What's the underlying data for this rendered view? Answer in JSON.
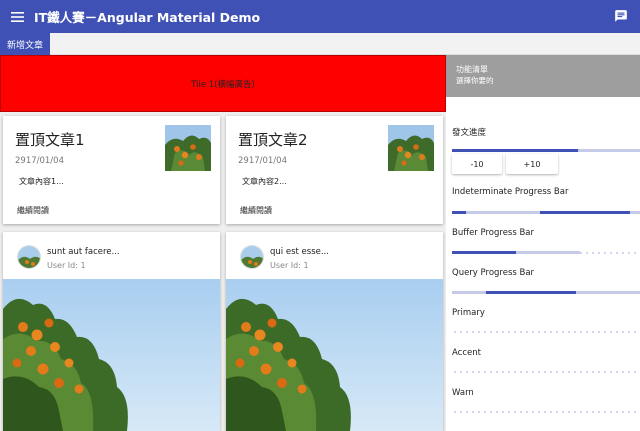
{
  "header": {
    "title": "IT鐵人賽－Angular Material Demo",
    "menu_icon": "menu-icon",
    "chat_icon": "chat-icon"
  },
  "tabs": [
    {
      "label": "新增文章",
      "active": true
    }
  ],
  "banner_tile": {
    "label": "Tile 1(橫幅廣告)"
  },
  "side_header": {
    "title": "功能清單",
    "subtitle": "選擇你要的"
  },
  "pinned_posts": [
    {
      "title": "置頂文章1",
      "date": "2917/01/04",
      "body": "文章內容1...",
      "read_more": "繼續閱讀"
    },
    {
      "title": "置頂文章2",
      "date": "2917/01/04",
      "body": "文章內容2...",
      "read_more": "繼續閱讀"
    }
  ],
  "posts": [
    {
      "title": "sunt aut facere...",
      "user": "User Id: 1"
    },
    {
      "title": "qui est esse...",
      "user": "User Id: 1"
    }
  ],
  "progress": {
    "heading": "發文進度",
    "value_fraction": 0.67,
    "minus_label": "-10",
    "plus_label": "+10"
  },
  "indeterminate": {
    "label": "Indeterminate Progress Bar"
  },
  "buffer": {
    "label": "Buffer Progress Bar",
    "value_fraction": 0.34,
    "buffer_fraction": 0.68
  },
  "query": {
    "label": "Query Progress Bar"
  },
  "primary": {
    "label": "Primary"
  },
  "accent": {
    "label": "Accent"
  },
  "warn": {
    "label": "Warn"
  },
  "colors": {
    "primary": "#3f51b5",
    "primary_light": "#c5cae9",
    "banner": "#ff0000",
    "side_header": "#9e9e9e"
  }
}
